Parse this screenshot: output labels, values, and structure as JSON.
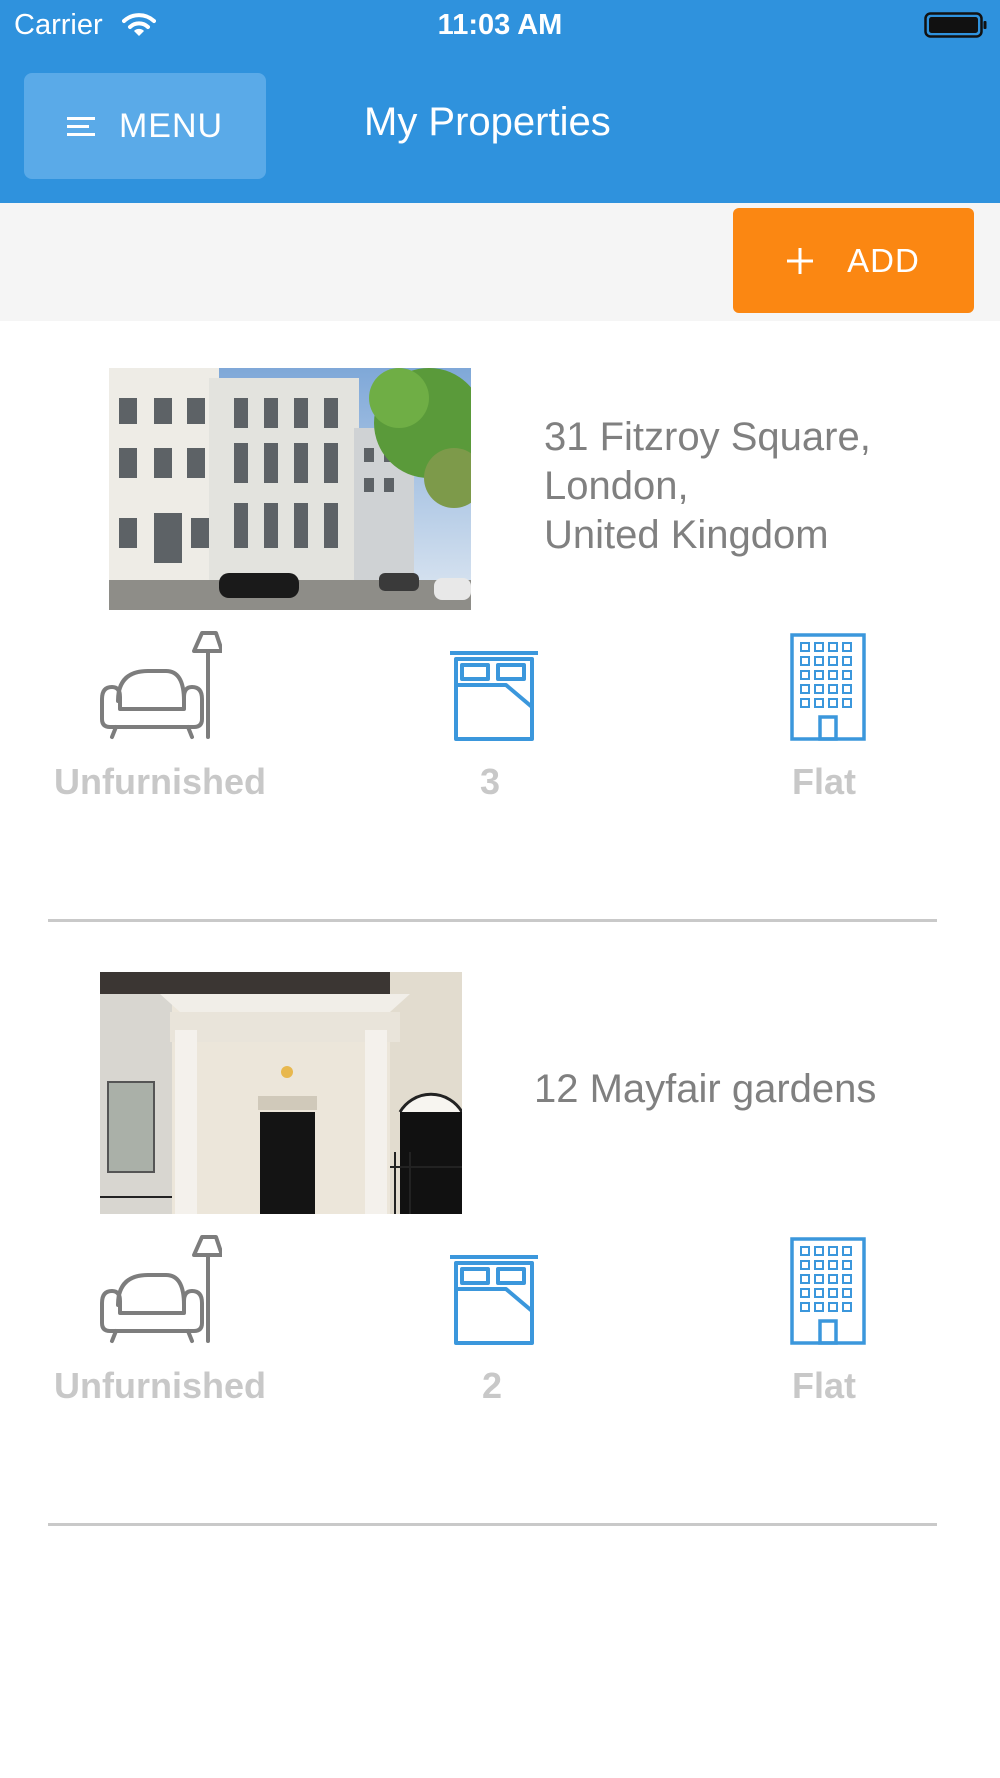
{
  "status_bar": {
    "carrier": "Carrier",
    "time": "11:03 AM"
  },
  "header": {
    "menu_label": "MENU",
    "title": "My Properties"
  },
  "toolbar": {
    "add_label": "ADD"
  },
  "properties": [
    {
      "address_lines": [
        "31 Fitzroy Square,",
        "London,",
        "United Kingdom"
      ],
      "furnishing": "Unfurnished",
      "bedrooms": "3",
      "property_type": "Flat"
    },
    {
      "address_lines": [
        "12 Mayfair gardens"
      ],
      "furnishing": "Unfurnished",
      "bedrooms": "2",
      "property_type": "Flat"
    }
  ],
  "colors": {
    "header": "#2f92dd",
    "add_button": "#fb8712",
    "icon_blue": "#3b97dc",
    "icon_grey": "#7d7d7d"
  },
  "icons": [
    "wifi-icon",
    "battery-icon",
    "menu-icon",
    "plus-icon",
    "armchair-lamp-icon",
    "bed-icon",
    "building-icon"
  ]
}
